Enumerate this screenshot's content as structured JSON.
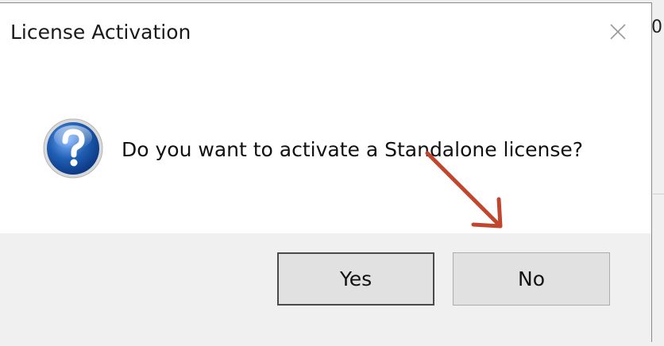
{
  "background": {
    "partial_text": "0"
  },
  "dialog": {
    "title": "License Activation",
    "close_label": "×",
    "message": "Do you want to activate a Standalone license?",
    "icon": "question-icon",
    "buttons": {
      "yes": "Yes",
      "no": "No"
    }
  },
  "annotation": {
    "arrow_color": "#c0472e",
    "points_to": "no-button"
  },
  "colors": {
    "dialog_bg": "#ffffff",
    "footer_bg": "#f0f0f0",
    "button_bg": "#e1e1e1",
    "icon_blue": "#1f5fb4"
  }
}
